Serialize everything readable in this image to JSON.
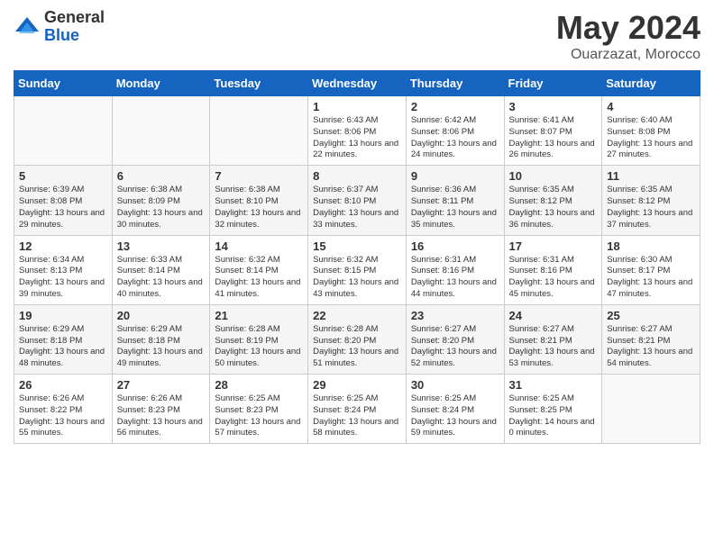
{
  "header": {
    "logo_general": "General",
    "logo_blue": "Blue",
    "title": "May 2024",
    "location": "Ouarzazat, Morocco"
  },
  "days_of_week": [
    "Sunday",
    "Monday",
    "Tuesday",
    "Wednesday",
    "Thursday",
    "Friday",
    "Saturday"
  ],
  "weeks": [
    [
      {
        "day": "",
        "info": ""
      },
      {
        "day": "",
        "info": ""
      },
      {
        "day": "",
        "info": ""
      },
      {
        "day": "1",
        "info": "Sunrise: 6:43 AM\nSunset: 8:06 PM\nDaylight: 13 hours and 22 minutes."
      },
      {
        "day": "2",
        "info": "Sunrise: 6:42 AM\nSunset: 8:06 PM\nDaylight: 13 hours and 24 minutes."
      },
      {
        "day": "3",
        "info": "Sunrise: 6:41 AM\nSunset: 8:07 PM\nDaylight: 13 hours and 26 minutes."
      },
      {
        "day": "4",
        "info": "Sunrise: 6:40 AM\nSunset: 8:08 PM\nDaylight: 13 hours and 27 minutes."
      }
    ],
    [
      {
        "day": "5",
        "info": "Sunrise: 6:39 AM\nSunset: 8:08 PM\nDaylight: 13 hours and 29 minutes."
      },
      {
        "day": "6",
        "info": "Sunrise: 6:38 AM\nSunset: 8:09 PM\nDaylight: 13 hours and 30 minutes."
      },
      {
        "day": "7",
        "info": "Sunrise: 6:38 AM\nSunset: 8:10 PM\nDaylight: 13 hours and 32 minutes."
      },
      {
        "day": "8",
        "info": "Sunrise: 6:37 AM\nSunset: 8:10 PM\nDaylight: 13 hours and 33 minutes."
      },
      {
        "day": "9",
        "info": "Sunrise: 6:36 AM\nSunset: 8:11 PM\nDaylight: 13 hours and 35 minutes."
      },
      {
        "day": "10",
        "info": "Sunrise: 6:35 AM\nSunset: 8:12 PM\nDaylight: 13 hours and 36 minutes."
      },
      {
        "day": "11",
        "info": "Sunrise: 6:35 AM\nSunset: 8:12 PM\nDaylight: 13 hours and 37 minutes."
      }
    ],
    [
      {
        "day": "12",
        "info": "Sunrise: 6:34 AM\nSunset: 8:13 PM\nDaylight: 13 hours and 39 minutes."
      },
      {
        "day": "13",
        "info": "Sunrise: 6:33 AM\nSunset: 8:14 PM\nDaylight: 13 hours and 40 minutes."
      },
      {
        "day": "14",
        "info": "Sunrise: 6:32 AM\nSunset: 8:14 PM\nDaylight: 13 hours and 41 minutes."
      },
      {
        "day": "15",
        "info": "Sunrise: 6:32 AM\nSunset: 8:15 PM\nDaylight: 13 hours and 43 minutes."
      },
      {
        "day": "16",
        "info": "Sunrise: 6:31 AM\nSunset: 8:16 PM\nDaylight: 13 hours and 44 minutes."
      },
      {
        "day": "17",
        "info": "Sunrise: 6:31 AM\nSunset: 8:16 PM\nDaylight: 13 hours and 45 minutes."
      },
      {
        "day": "18",
        "info": "Sunrise: 6:30 AM\nSunset: 8:17 PM\nDaylight: 13 hours and 47 minutes."
      }
    ],
    [
      {
        "day": "19",
        "info": "Sunrise: 6:29 AM\nSunset: 8:18 PM\nDaylight: 13 hours and 48 minutes."
      },
      {
        "day": "20",
        "info": "Sunrise: 6:29 AM\nSunset: 8:18 PM\nDaylight: 13 hours and 49 minutes."
      },
      {
        "day": "21",
        "info": "Sunrise: 6:28 AM\nSunset: 8:19 PM\nDaylight: 13 hours and 50 minutes."
      },
      {
        "day": "22",
        "info": "Sunrise: 6:28 AM\nSunset: 8:20 PM\nDaylight: 13 hours and 51 minutes."
      },
      {
        "day": "23",
        "info": "Sunrise: 6:27 AM\nSunset: 8:20 PM\nDaylight: 13 hours and 52 minutes."
      },
      {
        "day": "24",
        "info": "Sunrise: 6:27 AM\nSunset: 8:21 PM\nDaylight: 13 hours and 53 minutes."
      },
      {
        "day": "25",
        "info": "Sunrise: 6:27 AM\nSunset: 8:21 PM\nDaylight: 13 hours and 54 minutes."
      }
    ],
    [
      {
        "day": "26",
        "info": "Sunrise: 6:26 AM\nSunset: 8:22 PM\nDaylight: 13 hours and 55 minutes."
      },
      {
        "day": "27",
        "info": "Sunrise: 6:26 AM\nSunset: 8:23 PM\nDaylight: 13 hours and 56 minutes."
      },
      {
        "day": "28",
        "info": "Sunrise: 6:25 AM\nSunset: 8:23 PM\nDaylight: 13 hours and 57 minutes."
      },
      {
        "day": "29",
        "info": "Sunrise: 6:25 AM\nSunset: 8:24 PM\nDaylight: 13 hours and 58 minutes."
      },
      {
        "day": "30",
        "info": "Sunrise: 6:25 AM\nSunset: 8:24 PM\nDaylight: 13 hours and 59 minutes."
      },
      {
        "day": "31",
        "info": "Sunrise: 6:25 AM\nSunset: 8:25 PM\nDaylight: 14 hours and 0 minutes."
      },
      {
        "day": "",
        "info": ""
      }
    ]
  ]
}
